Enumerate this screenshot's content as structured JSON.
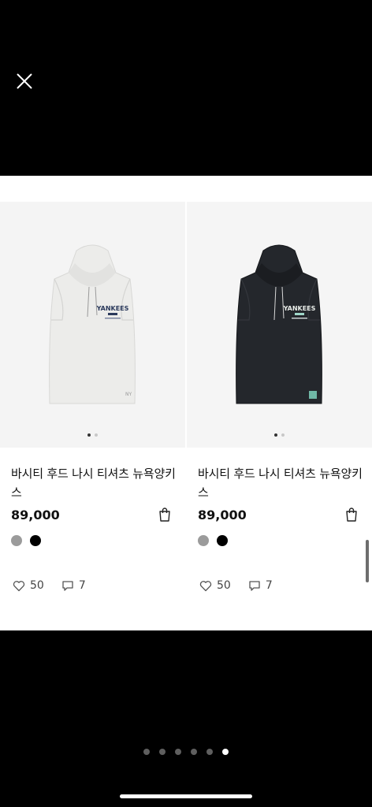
{
  "products": [
    {
      "name": "바시티 후드 나시 티셔츠 뉴욕양키스",
      "price": "89,000",
      "likes": "50",
      "comments": "7",
      "logo_text": "YANKEES",
      "swatch_colors": [
        "#9b9b9b",
        "#000000"
      ],
      "garment_color": "#efefed"
    },
    {
      "name": "바시티 후드 나시 티셔츠 뉴욕양키스",
      "price": "89,000",
      "likes": "50",
      "comments": "7",
      "logo_text": "YANKEES",
      "swatch_colors": [
        "#9b9b9b",
        "#000000"
      ],
      "garment_color": "#23262b"
    }
  ],
  "image_pager": {
    "count": 2,
    "active": 1
  },
  "page_pager": {
    "count": 6,
    "active": 6
  },
  "icons": {
    "close": "close-icon",
    "cart": "shopping-bag-icon",
    "like": "heart-icon",
    "comment": "comment-icon"
  }
}
